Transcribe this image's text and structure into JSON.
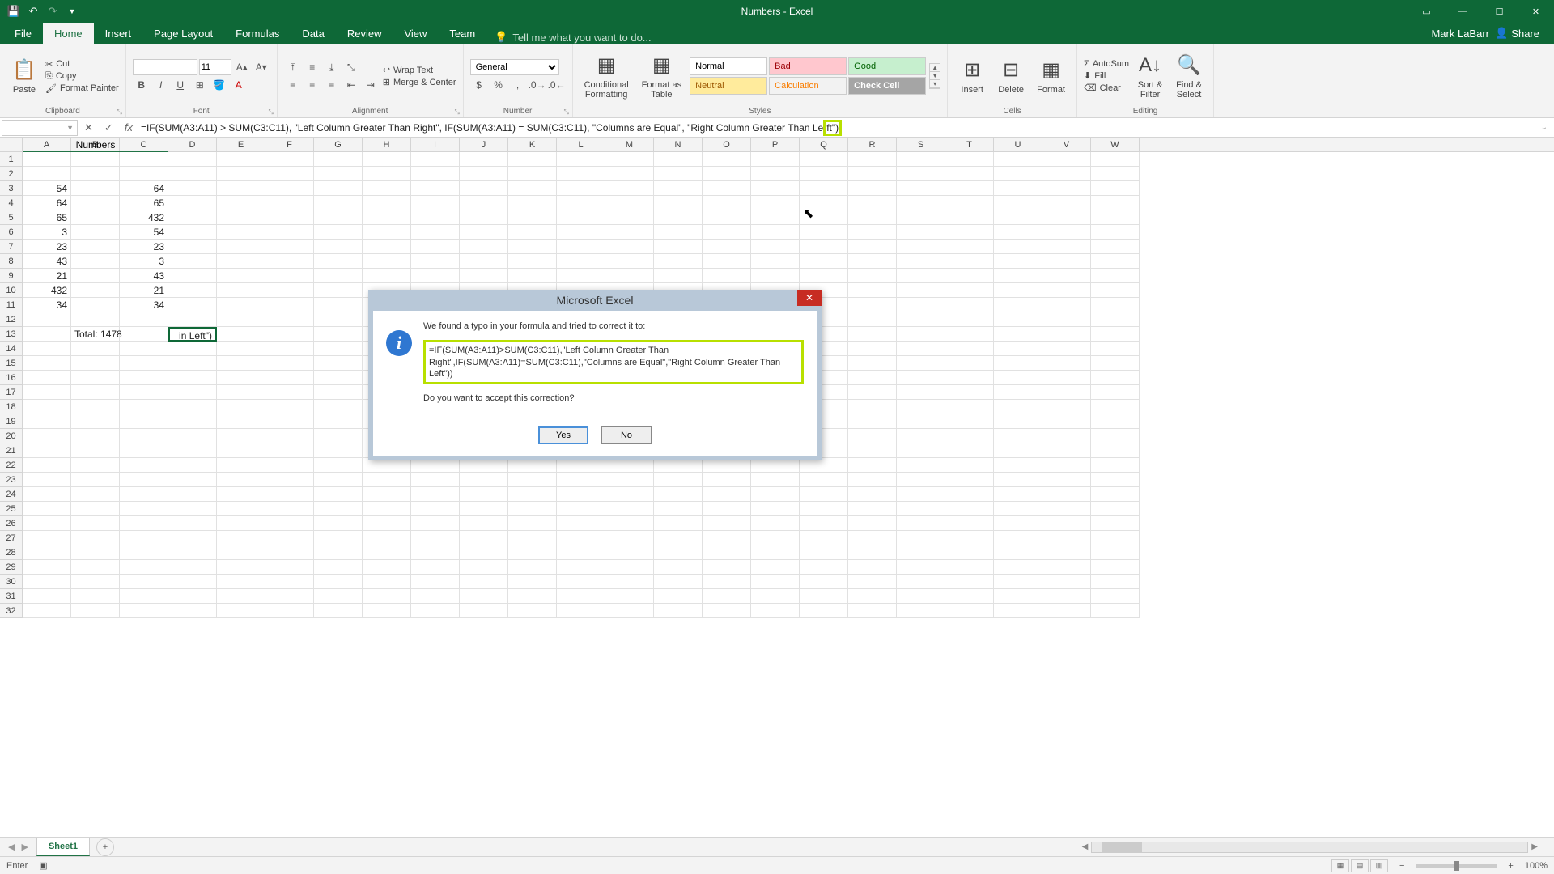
{
  "title": "Numbers - Excel",
  "account_name": "Mark LaBarr",
  "share_label": "Share",
  "tabs": [
    "File",
    "Home",
    "Insert",
    "Page Layout",
    "Formulas",
    "Data",
    "Review",
    "View",
    "Team"
  ],
  "active_tab": "Home",
  "tellme_placeholder": "Tell me what you want to do...",
  "ribbon": {
    "clipboard": {
      "label": "Clipboard",
      "paste": "Paste",
      "cut": "Cut",
      "copy": "Copy",
      "painter": "Format Painter"
    },
    "font": {
      "label": "Font",
      "size": "11"
    },
    "alignment": {
      "label": "Alignment",
      "wrap": "Wrap Text",
      "merge": "Merge & Center"
    },
    "number": {
      "label": "Number",
      "format": "General"
    },
    "styles": {
      "label": "Styles",
      "cond": "Conditional\nFormatting",
      "fat": "Format as\nTable",
      "normal": "Normal",
      "bad": "Bad",
      "good": "Good",
      "neutral": "Neutral",
      "calc": "Calculation",
      "check": "Check Cell"
    },
    "cells": {
      "label": "Cells",
      "insert": "Insert",
      "delete": "Delete",
      "format": "Format"
    },
    "editing": {
      "label": "Editing",
      "autosum": "AutoSum",
      "fill": "Fill",
      "clear": "Clear",
      "sort": "Sort &\nFilter",
      "find": "Find &\nSelect"
    }
  },
  "namebox": "",
  "formula_prefix": "=IF(SUM(A3:A11) > SUM(C3:C11), \"Left Column Greater Than Right\", IF(SUM(A3:A11) = SUM(C3:C11), \"Columns are Equal\", \"Right Column Greater Than Le",
  "formula_hl": "ft\")",
  "columns": [
    "A",
    "B",
    "C",
    "D",
    "E",
    "F",
    "G",
    "H",
    "I",
    "J",
    "K",
    "L",
    "M",
    "N",
    "O",
    "P",
    "Q",
    "R",
    "S",
    "T",
    "U",
    "V",
    "W"
  ],
  "data": {
    "header": "Numbers",
    "colA": [
      "54",
      "64",
      "65",
      "3",
      "23",
      "43",
      "21",
      "432",
      "34"
    ],
    "colC": [
      "64",
      "65",
      "432",
      "54",
      "23",
      "3",
      "43",
      "21",
      "34"
    ],
    "b13": "Total: 1478",
    "d13": "in Left\")"
  },
  "dialog": {
    "title": "Microsoft Excel",
    "line1": "We found a typo in your formula and tried to correct it to:",
    "formula": "=IF(SUM(A3:A11)>SUM(C3:C11),\"Left Column Greater Than Right\",IF(SUM(A3:A11)=SUM(C3:C11),\"Columns are Equal\",\"Right Column Greater Than Left\"))",
    "line2": "Do you want to accept this correction?",
    "yes": "Yes",
    "no": "No"
  },
  "sheet_name": "Sheet1",
  "status_mode": "Enter",
  "zoom": "100%"
}
